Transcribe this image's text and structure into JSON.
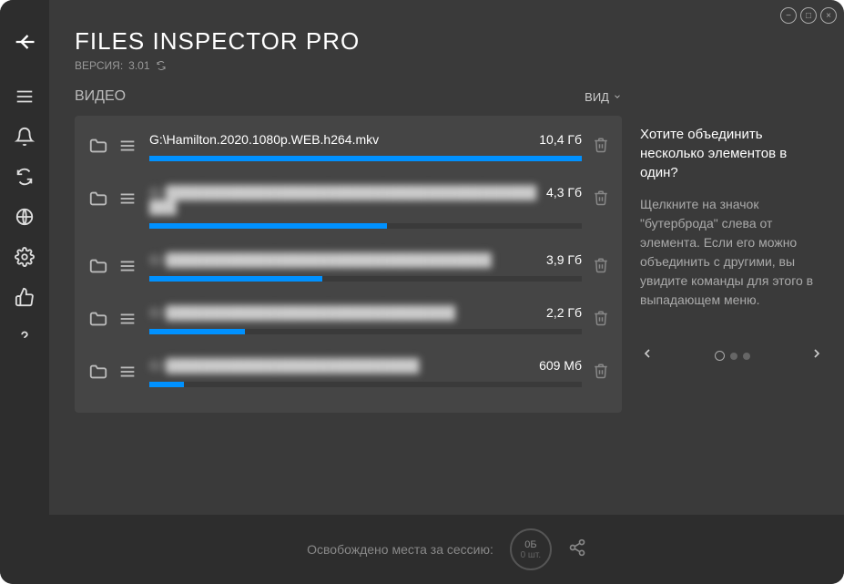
{
  "header": {
    "title": "FILES INSPECTOR PRO",
    "version_prefix": "ВЕРСИЯ:",
    "version": "3.01"
  },
  "list": {
    "section": "ВИДЕО",
    "view_label": "ВИД",
    "items": [
      {
        "name": "G:\\Hamilton.2020.1080p.WEB.h264.mkv",
        "size": "10,4 Гб",
        "blur": false,
        "pct": 100
      },
      {
        "name": "G:\\████████████████████████████████████████████",
        "size": "4,3 Гб",
        "blur": true,
        "pct": 55
      },
      {
        "name": "G:\\████████████████████████████████████",
        "size": "3,9 Гб",
        "blur": true,
        "pct": 40
      },
      {
        "name": "G:\\████████████████████████████████",
        "size": "2,2 Гб",
        "blur": true,
        "pct": 22
      },
      {
        "name": "G:\\████████████████████████████",
        "size": "609 Мб",
        "blur": true,
        "pct": 8
      }
    ]
  },
  "tips": {
    "title": "Хотите объединить несколько элементов в один?",
    "body": "Щелкните на значок \"бутерброда\" слева от элемента. Если его можно объединить с другими, вы увидите команды для этого в выпадающем меню."
  },
  "footer": {
    "label": "Освобождено места за сессию:",
    "size": "0Б",
    "count": "0 шт."
  }
}
